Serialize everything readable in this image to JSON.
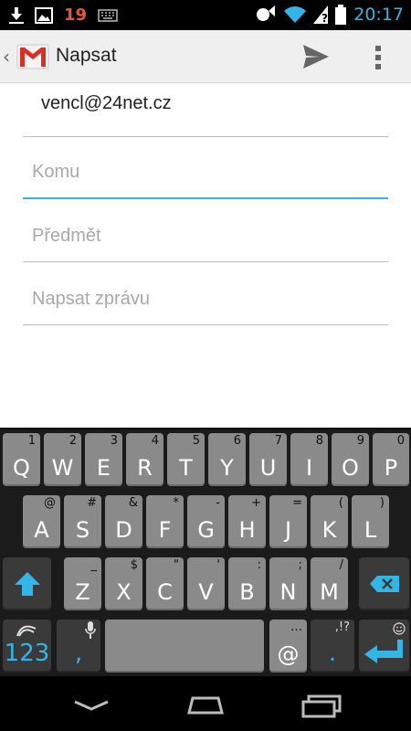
{
  "status_bar": {
    "icons": [
      "download-icon",
      "image-icon"
    ],
    "notification_count": "19",
    "right_icons": [
      "alarm-icon",
      "wifi-icon",
      "signal-icon",
      "battery-icon"
    ],
    "time": "20:17"
  },
  "action_bar": {
    "title": "Napsat",
    "icons": {
      "app": "gmail-icon",
      "send": "send-icon",
      "menu": "overflow-menu-icon"
    }
  },
  "compose": {
    "from": "vencl@24net.cz",
    "to_placeholder": "Komu",
    "subject_placeholder": "Předmět",
    "body_placeholder": "Napsat zprávu"
  },
  "keyboard": {
    "row1": [
      {
        "key": "Q",
        "hint": "1"
      },
      {
        "key": "W",
        "hint": "2"
      },
      {
        "key": "E",
        "hint": "3"
      },
      {
        "key": "R",
        "hint": "4"
      },
      {
        "key": "T",
        "hint": "5"
      },
      {
        "key": "Y",
        "hint": "6"
      },
      {
        "key": "U",
        "hint": "7"
      },
      {
        "key": "I",
        "hint": "8"
      },
      {
        "key": "O",
        "hint": "9"
      },
      {
        "key": "P",
        "hint": "0"
      }
    ],
    "row2": [
      {
        "key": "A",
        "hint": "@"
      },
      {
        "key": "S",
        "hint": "#"
      },
      {
        "key": "D",
        "hint": "&"
      },
      {
        "key": "F",
        "hint": "*"
      },
      {
        "key": "G",
        "hint": "-"
      },
      {
        "key": "H",
        "hint": "+"
      },
      {
        "key": "J",
        "hint": "="
      },
      {
        "key": "K",
        "hint": "("
      },
      {
        "key": "L",
        "hint": ")"
      }
    ],
    "row3": [
      {
        "key": "Z",
        "hint": "_"
      },
      {
        "key": "X",
        "hint": "$"
      },
      {
        "key": "C",
        "hint": "\""
      },
      {
        "key": "V",
        "hint": "'"
      },
      {
        "key": "B",
        "hint": ":"
      },
      {
        "key": "N",
        "hint": ";"
      },
      {
        "key": "M",
        "hint": "/"
      }
    ],
    "numbers_label": "123",
    "comma": ",",
    "at": "@",
    "at_hint": "…",
    "period": ".",
    "period_hint": ",!?"
  },
  "nav_bar": {
    "icons": [
      "back-icon",
      "home-icon",
      "recents-icon"
    ]
  }
}
